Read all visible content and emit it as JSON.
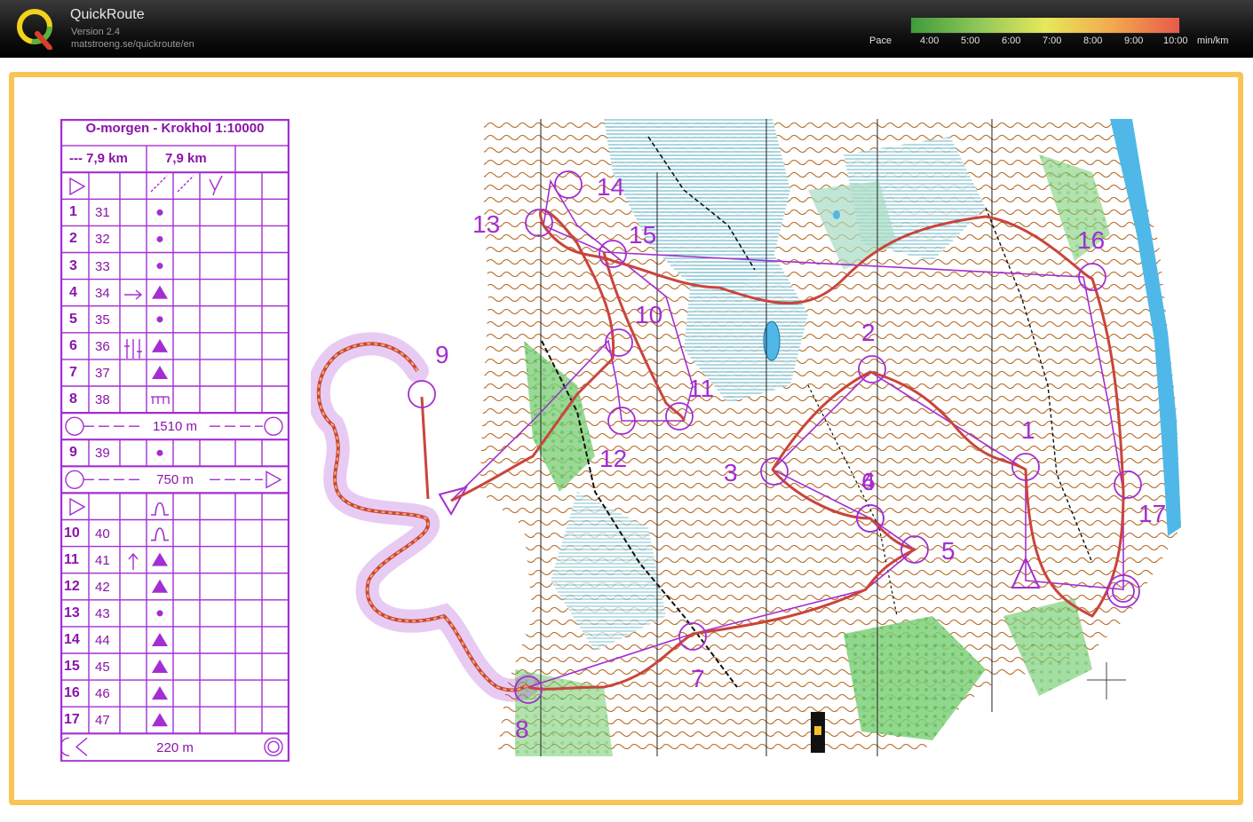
{
  "app": {
    "name": "QuickRoute",
    "version": "Version 2.4",
    "url": "matstroeng.se/quickroute/en"
  },
  "pace_scale": {
    "label": "Pace",
    "ticks": [
      "4:00",
      "5:00",
      "6:00",
      "7:00",
      "8:00",
      "9:00",
      "10:00"
    ],
    "unit": "min/km",
    "colors": [
      "#3f9b3a",
      "#8fc65a",
      "#e6e85a",
      "#f2a94f",
      "#e85a4a"
    ]
  },
  "course": {
    "title": "O-morgen - Krokhol 1:10000",
    "length_a": "--- 7,9 km",
    "length_b": "7,9 km",
    "controls": [
      {
        "num": "1",
        "code": "31",
        "symbol": "dot"
      },
      {
        "num": "2",
        "code": "32",
        "symbol": "dot"
      },
      {
        "num": "3",
        "code": "33",
        "symbol": "dot"
      },
      {
        "num": "4",
        "code": "34",
        "symbol": "triangle"
      },
      {
        "num": "5",
        "code": "35",
        "symbol": "dot"
      },
      {
        "num": "6",
        "code": "36",
        "symbol": "triangle"
      },
      {
        "num": "7",
        "code": "37",
        "symbol": "triangle"
      },
      {
        "num": "8",
        "code": "38",
        "symbol": "comb"
      },
      {
        "num": "9",
        "code": "39",
        "symbol": "dot"
      },
      {
        "num": "10",
        "code": "40",
        "symbol": "bump"
      },
      {
        "num": "11",
        "code": "41",
        "symbol": "triangle"
      },
      {
        "num": "12",
        "code": "42",
        "symbol": "triangle"
      },
      {
        "num": "13",
        "code": "43",
        "symbol": "dot"
      },
      {
        "num": "14",
        "code": "44",
        "symbol": "triangle"
      },
      {
        "num": "15",
        "code": "45",
        "symbol": "triangle"
      },
      {
        "num": "16",
        "code": "46",
        "symbol": "triangle"
      },
      {
        "num": "17",
        "code": "47",
        "symbol": "triangle"
      }
    ],
    "taped_1": "1510 m",
    "taped_2": "750 m",
    "finish": "220 m"
  },
  "map_labels": [
    "1",
    "2",
    "3",
    "4",
    "5",
    "6",
    "7",
    "8",
    "9",
    "10",
    "11",
    "12",
    "13",
    "14",
    "15",
    "16",
    "17"
  ],
  "colors": {
    "course_purple": "#a32ed1",
    "frame_orange": "#f8c453",
    "route_red": "#c9453c"
  }
}
